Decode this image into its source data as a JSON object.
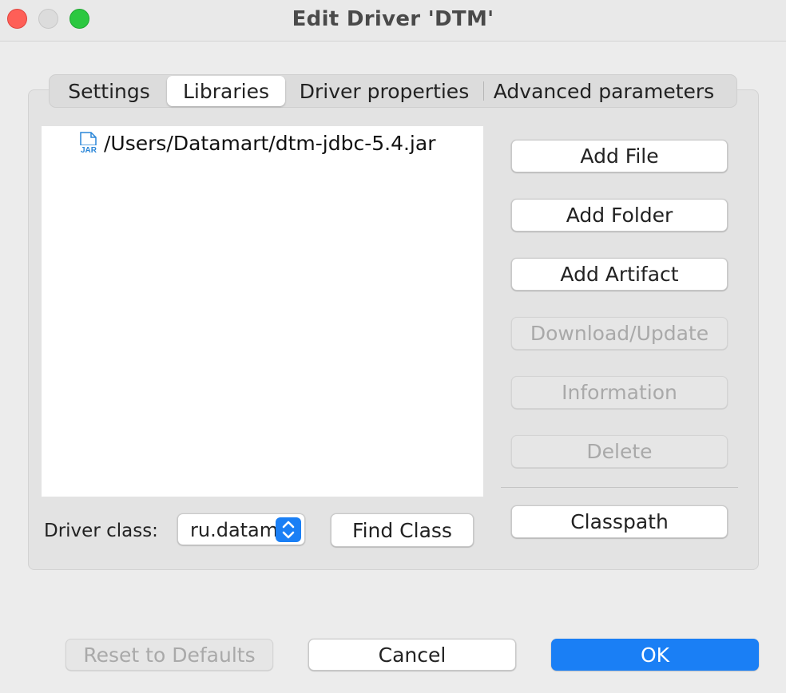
{
  "window": {
    "title": "Edit Driver 'DTM'"
  },
  "tabs": [
    {
      "label": "Settings",
      "selected": false
    },
    {
      "label": "Libraries",
      "selected": true
    },
    {
      "label": "Driver properties",
      "selected": false
    },
    {
      "label": "Advanced parameters",
      "selected": false
    }
  ],
  "libraries": {
    "items": [
      {
        "icon": "jar-file-icon",
        "icon_text": "JAR",
        "path": "/Users/Datamart/dtm-jdbc-5.4.jar"
      }
    ]
  },
  "side_buttons": {
    "add_file": "Add File",
    "add_folder": "Add Folder",
    "add_artifact": "Add Artifact",
    "download_update": "Download/Update",
    "information": "Information",
    "delete": "Delete",
    "classpath": "Classpath"
  },
  "driver_class": {
    "label": "Driver class:",
    "value": "ru.datamart",
    "find_class_label": "Find Class"
  },
  "footer": {
    "reset_label": "Reset to Defaults",
    "cancel_label": "Cancel",
    "ok_label": "OK"
  },
  "colors": {
    "accent": "#1a7ff5",
    "close": "#fe5f57",
    "maximize": "#2bc840",
    "jar_icon": "#2a86d8"
  }
}
